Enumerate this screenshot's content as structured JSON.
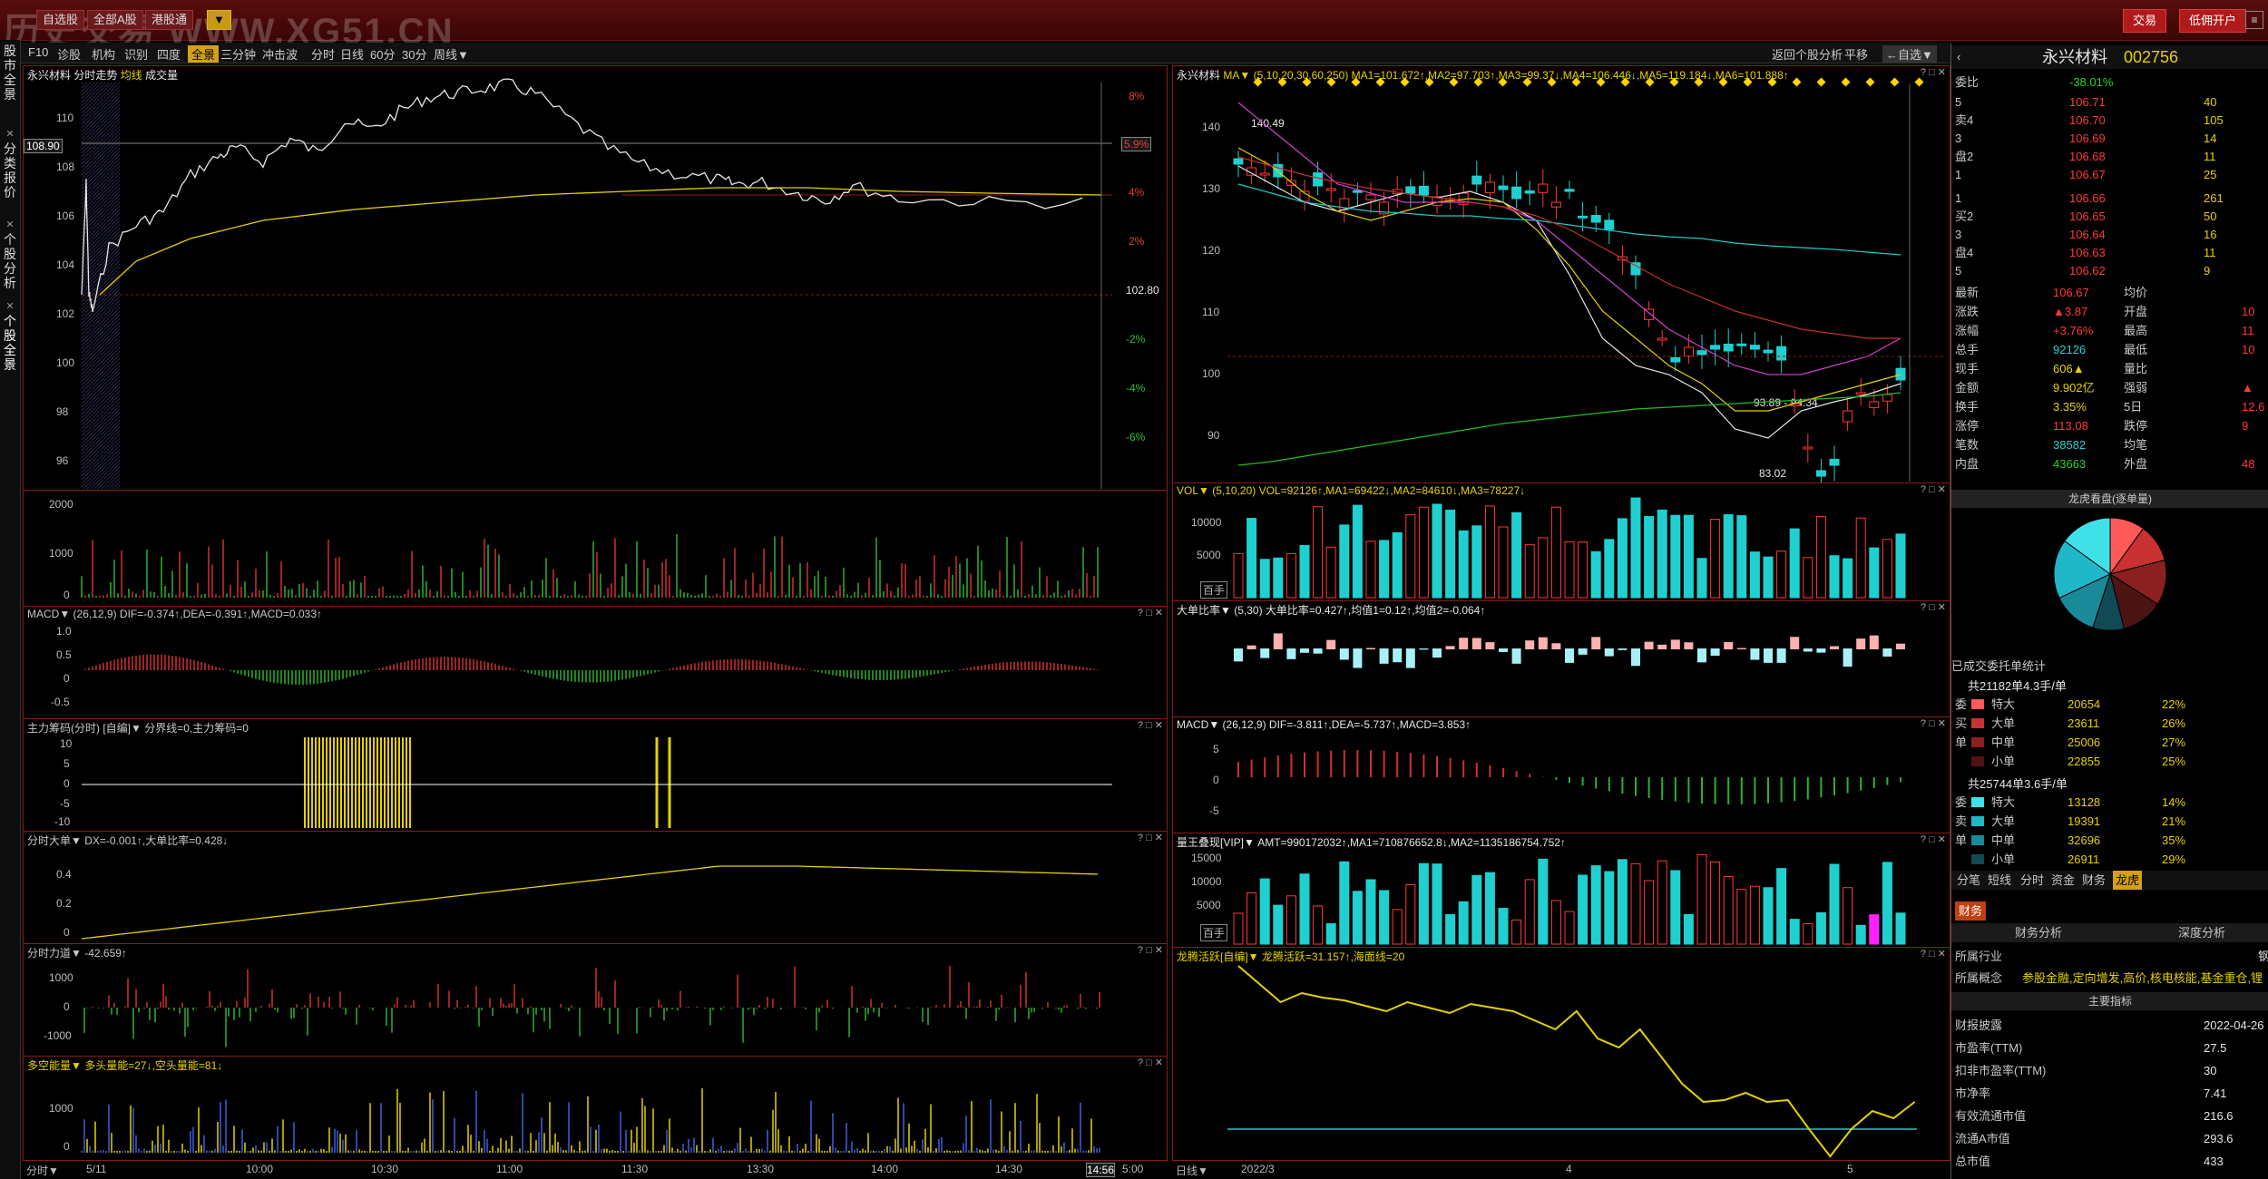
{
  "topbar": {
    "watermark": "历史交易 WWW.XG51.CN",
    "buttons": [
      "自选股",
      "全部A股",
      "港股通",
      "▼"
    ],
    "trade_btn": "交易",
    "open_btn": "低佣开户"
  },
  "sidetabs": [
    "股市全景",
    "分类报价",
    "个股分析",
    "个股全景"
  ],
  "toolbar": {
    "items": [
      "F10",
      "诊股",
      "机构",
      "识别",
      "四度",
      "全景",
      "三分钟",
      "冲击波",
      "分时",
      "日线",
      "60分",
      "30分",
      "周线▼"
    ],
    "selected": "全景",
    "right_items": [
      "返回个股分析",
      "平移",
      "←自选▼"
    ]
  },
  "intraday": {
    "title": "永兴材料",
    "subtitle": "分时走势",
    "legend_avg": "均线",
    "legend_vol": "成交量",
    "yticks_left": [
      "110",
      "108",
      "106",
      "104",
      "102",
      "100",
      "98",
      "96"
    ],
    "yticks_right": [
      "8%",
      "6%",
      "4%",
      "2%",
      "102.80",
      "-2%",
      "-4%",
      "-6%"
    ],
    "price_tag": "108.90",
    "pct_tag": "5.9%",
    "vol_yticks": [
      "2000",
      "1000",
      "0"
    ],
    "macd_title": "MACD▼ (26,12,9) DIF=-0.374↑,DEA=-0.391↑,MACD=0.033↑",
    "macd_yticks": [
      "1.0",
      "0.5",
      "0",
      "-0.5"
    ],
    "zhuli_title": "主力筹码(分时) [自编]▼ 分界线=0,主力筹码=0",
    "zhuli_yticks": [
      "10",
      "5",
      "0",
      "-5",
      "-10"
    ],
    "dadan_title": "分时大单▼ DX=-0.001↑,大单比率=0.428↓",
    "dadan_yticks": [
      "0.4",
      "0.2",
      "0"
    ],
    "lidao_title": "分时力道▼ -42.659↑",
    "lidao_yticks": [
      "1000",
      "0",
      "-1000"
    ],
    "duokong_title": "多空能量▼ 多头量能=27↓,空头量能=81↓",
    "duokong_yticks": [
      "1000",
      "0"
    ],
    "xaxis": [
      "分时▼",
      "5/11",
      "10:00",
      "10:30",
      "11:00",
      "11:30",
      "13:30",
      "14:00",
      "14:30",
      "14:56",
      "5:00"
    ],
    "close_ref": 102.8
  },
  "daily": {
    "title": "永兴材料",
    "ma_title": "MA▼ (5,10,20,30,60,250) MA1=101.672↑,MA2=97.703↑,MA3=99.37↓,MA4=106.446↓,MA5=119.184↓,MA6=101.888↑",
    "yticks": [
      "140",
      "130",
      "120",
      "110",
      "100",
      "90"
    ],
    "high_label": "140.49",
    "low_label": "83.02",
    "range_label": "93.89 - 94.34",
    "vol_title": "VOL▼ (5,10,20) VOL=92126↑,MA1=69422↓,MA2=84610↓,MA3=78227↓",
    "vol_yticks": [
      "10000",
      "5000",
      "百手"
    ],
    "dadan_title": "大单比率▼ (5,30) 大单比率=0.427↑,均值1=0.12↑,均值2=-0.064↑",
    "macd_title": "MACD▼ (26,12,9) DIF=-3.811↑,DEA=-5.737↑,MACD=3.853↑",
    "macd_yticks": [
      "5",
      "0",
      "-5"
    ],
    "liang_title": "量王叠现[VIP]▼ AMT=990172032↑,MA1=710876652.8↓,MA2=1135186754.752↑",
    "liang_yticks": [
      "15000",
      "10000",
      "5000",
      "百手"
    ],
    "longteng_title": "龙腾活跃[自编]▼ 龙腾活跃=31.157↑,海面线=20",
    "xaxis": [
      "日线▼",
      "2022/3",
      "4",
      "5"
    ]
  },
  "quote": {
    "name": "永兴材料",
    "code": "002756",
    "weibi_label": "委比",
    "weibi": "-38.01%",
    "sell": [
      {
        "lbl": "5",
        "price": "106.71",
        "vol": "40"
      },
      {
        "lbl": "卖4",
        "price": "106.70",
        "vol": "105"
      },
      {
        "lbl": "3",
        "price": "106.69",
        "vol": "14"
      },
      {
        "lbl": "盘2",
        "price": "106.68",
        "vol": "11"
      },
      {
        "lbl": "1",
        "price": "106.67",
        "vol": "25"
      }
    ],
    "buy": [
      {
        "lbl": "1",
        "price": "106.66",
        "vol": "261"
      },
      {
        "lbl": "买2",
        "price": "106.65",
        "vol": "50"
      },
      {
        "lbl": "3",
        "price": "106.64",
        "vol": "16"
      },
      {
        "lbl": "盘4",
        "price": "106.63",
        "vol": "11"
      },
      {
        "lbl": "5",
        "price": "106.62",
        "vol": "9"
      }
    ],
    "stats": [
      {
        "k1": "最新",
        "v1": "106.67",
        "c1": "red",
        "k2": "均价",
        "v2": ""
      },
      {
        "k1": "涨跌",
        "v1": "▲3.87",
        "c1": "red",
        "k2": "开盘",
        "v2": "10"
      },
      {
        "k1": "涨幅",
        "v1": "+3.76%",
        "c1": "red",
        "k2": "最高",
        "v2": "11"
      },
      {
        "k1": "总手",
        "v1": "92126",
        "c1": "cyan",
        "k2": "最低",
        "v2": "10"
      },
      {
        "k1": "现手",
        "v1": "606▲",
        "c1": "yellow",
        "k2": "量比",
        "v2": ""
      },
      {
        "k1": "金额",
        "v1": "9.902亿",
        "c1": "yellow",
        "k2": "强弱",
        "v2": "▲"
      },
      {
        "k1": "换手",
        "v1": "3.35%",
        "c1": "yellow",
        "k2": "5日",
        "v2": "12.6"
      },
      {
        "k1": "涨停",
        "v1": "113.08",
        "c1": "red",
        "k2": "跌停",
        "v2": "9"
      },
      {
        "k1": "笔数",
        "v1": "38582",
        "c1": "cyan",
        "k2": "均笔",
        "v2": ""
      },
      {
        "k1": "内盘",
        "v1": "43663",
        "c1": "green",
        "k2": "外盘",
        "v2": "48"
      }
    ],
    "pie_title": "龙虎看盘(逐单量)",
    "pie_slices": [
      0.1,
      0.11,
      0.13,
      0.12,
      0.09,
      0.13,
      0.17,
      0.15
    ],
    "pie_colors": [
      "#ff5a5a",
      "#c83232",
      "#8a2020",
      "#4d1414",
      "#0f4a55",
      "#1a8a9a",
      "#20b8c8",
      "#40e0e8"
    ],
    "deal_title": "已成交委托单统计",
    "buy_summary": "共21182单4.3手/单",
    "buy_rows": [
      {
        "side": "委",
        "name": "特大",
        "vol": "20654",
        "pct": "22%",
        "color": "#ff5a5a"
      },
      {
        "side": "买",
        "name": "大单",
        "vol": "23611",
        "pct": "26%",
        "color": "#c83232"
      },
      {
        "side": "单",
        "name": "中单",
        "vol": "25006",
        "pct": "27%",
        "color": "#8a2020"
      },
      {
        "side": "",
        "name": "小单",
        "vol": "22855",
        "pct": "25%",
        "color": "#4d1414"
      }
    ],
    "sell_summary": "共25744单3.6手/单",
    "sell_rows": [
      {
        "side": "委",
        "name": "特大",
        "vol": "13128",
        "pct": "14%",
        "color": "#40e0e8"
      },
      {
        "side": "卖",
        "name": "大单",
        "vol": "19391",
        "pct": "21%",
        "color": "#20b8c8"
      },
      {
        "side": "单",
        "name": "中单",
        "vol": "32696",
        "pct": "35%",
        "color": "#1a8a9a"
      },
      {
        "side": "",
        "name": "小单",
        "vol": "26911",
        "pct": "29%",
        "color": "#0f4a55"
      }
    ],
    "tabs": [
      "分笔",
      "短线",
      "分时",
      "资金",
      "财务",
      "龙虎"
    ],
    "selected_tab": "龙虎",
    "fin_tab": "财务",
    "fin_subtabs": [
      "财务分析",
      "深度分析"
    ],
    "industry_label": "所属行业",
    "industry_val": "钢",
    "concept_label": "所属概念",
    "concept_val": "参股金融,定向增发,高价,核电核能,基金重仓,锂",
    "main_idx": "主要指标",
    "fin_rows": [
      {
        "k": "财报披露",
        "v": "2022-04-26"
      },
      {
        "k": "市盈率(TTM)",
        "v": "27.5"
      },
      {
        "k": "扣非市盈率(TTM)",
        "v": "30"
      },
      {
        "k": "市净率",
        "v": "7.41"
      },
      {
        "k": "有效流通市值",
        "v": "216.6"
      },
      {
        "k": "流通A市值",
        "v": "293.6"
      },
      {
        "k": "总市值",
        "v": "433"
      }
    ]
  }
}
